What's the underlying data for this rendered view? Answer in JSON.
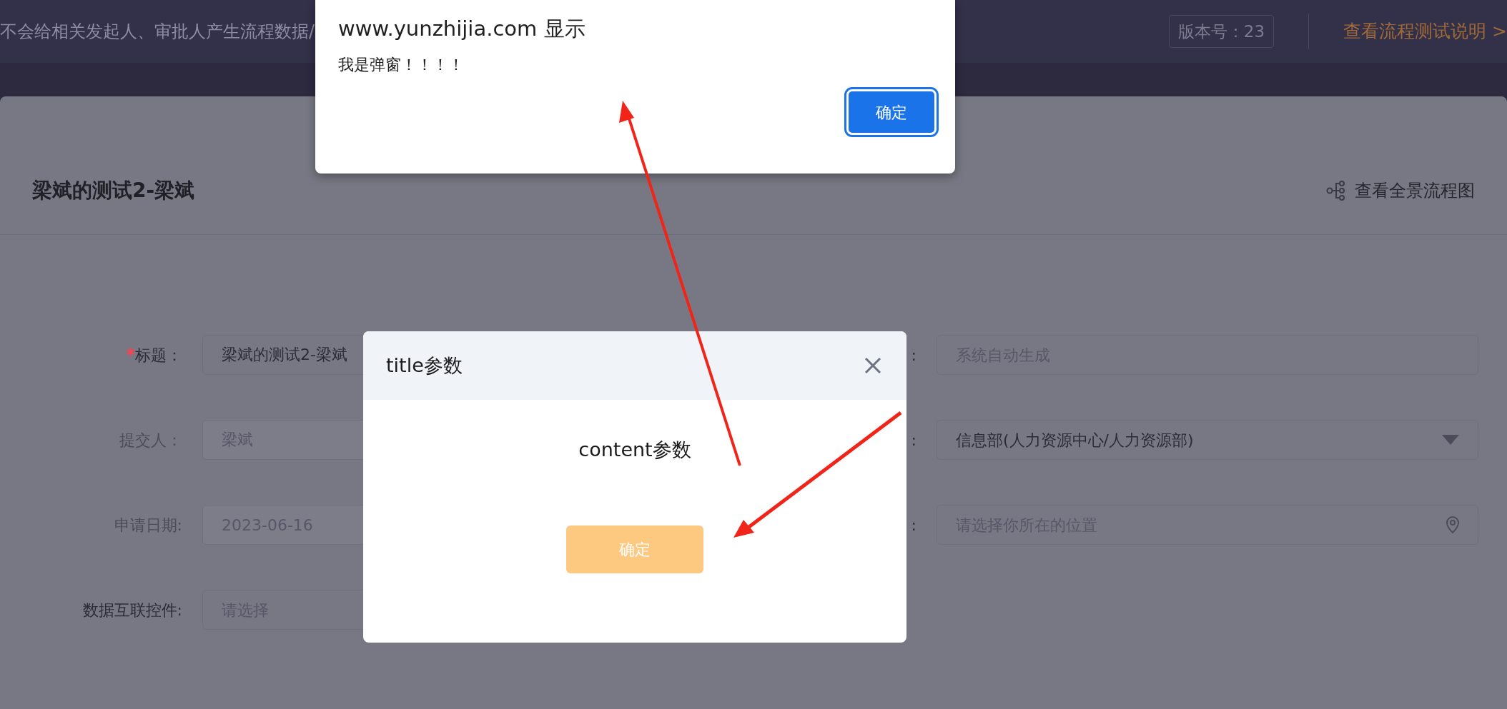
{
  "top_bar": {
    "notice": "不会给相关发起人、审批人产生流程数据/",
    "version": "版本号：23",
    "help_link": "查看流程测试说明 >"
  },
  "form": {
    "title": "梁斌的测试2-梁斌",
    "diagram_link": "查看全景流程图",
    "rows": [
      {
        "left": {
          "required_mark": "*",
          "label": "标题：",
          "kind": "text",
          "value": "梁斌的测试2-梁斌",
          "disabled": false
        },
        "right": {
          "label": ":",
          "kind": "text",
          "placeholder": "系统自动生成"
        }
      },
      {
        "left": {
          "label": "提交人：",
          "kind": "text",
          "value": "梁斌",
          "disabled": true
        },
        "right": {
          "label": ":",
          "kind": "select",
          "value": "信息部(人力资源中心/人力资源部)"
        }
      },
      {
        "left": {
          "label": "申请日期:",
          "kind": "text",
          "value": "2023-06-16",
          "disabled": true
        },
        "right": {
          "label": ":",
          "kind": "location",
          "placeholder": "请选择你所在的位置"
        }
      },
      {
        "left": {
          "label": "数据互联控件:",
          "kind": "text",
          "placeholder": "请选择"
        }
      }
    ]
  },
  "modal": {
    "title": "title参数",
    "content": "content参数",
    "button": "确定"
  },
  "alert": {
    "title": "www.yunzhijia.com 显示",
    "message": "我是弹窗！！！！",
    "button": "确定"
  }
}
